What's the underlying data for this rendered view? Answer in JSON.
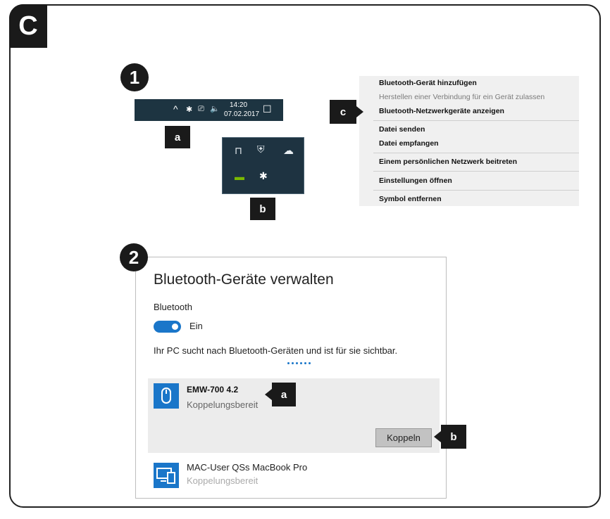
{
  "section": {
    "label": "C"
  },
  "steps": {
    "one": "1",
    "two": "2"
  },
  "callouts": {
    "a": "a",
    "b": "b",
    "c": "c"
  },
  "taskbar": {
    "chevron": "^",
    "bluetooth": "✱",
    "network": "⎚",
    "volume": "🔈",
    "time": "14:20",
    "date": "07.02.2017",
    "notify": "☐"
  },
  "tray": {
    "usb": "⊓",
    "shield": "⛨",
    "cloud": "☁",
    "gpu": "▬",
    "bluetooth": "✱"
  },
  "context_menu": {
    "items": [
      "Bluetooth-Gerät hinzufügen",
      "Herstellen einer Verbindung für ein Gerät zulassen",
      "Bluetooth-Netzwerkgeräte anzeigen",
      "Datei senden",
      "Datei empfangen",
      "Einem persönlichen Netzwerk beitreten",
      "Einstellungen öffnen",
      "Symbol entfernen"
    ]
  },
  "bt_panel": {
    "title": "Bluetooth-Geräte verwalten",
    "label": "Bluetooth",
    "toggle_state": "Ein",
    "search_text": "Ihr PC sucht nach Bluetooth-Geräten und ist für sie sichtbar.",
    "devices": [
      {
        "name": "EMW-700 4.2",
        "status": "Koppelungsbereit",
        "button": "Koppeln"
      },
      {
        "name": "MAC-User QSs MacBook Pro",
        "status": "Koppelungsbereit"
      }
    ]
  },
  "colors": {
    "accent": "#1a76c9",
    "taskbar": "#1d3441",
    "dark": "#1a1a1a"
  }
}
